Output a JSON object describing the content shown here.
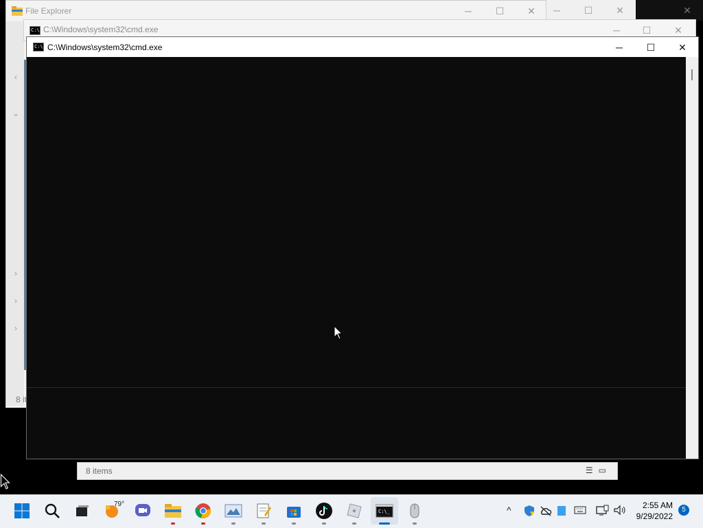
{
  "background_explorer": {
    "title": "File Explorer",
    "status": "8 it",
    "caption": {
      "minimize": "─",
      "maximize": "☐",
      "close": "✕"
    }
  },
  "bottom_explorer": {
    "status": "8 items"
  },
  "cmd_back": {
    "title": "C:\\Windows\\system32\\cmd.exe",
    "caption": {
      "minimize": "─",
      "maximize": "☐",
      "close": "✕"
    }
  },
  "cmd_active": {
    "title": "C:\\Windows\\system32\\cmd.exe",
    "icon_text": "C:\\",
    "caption": {
      "minimize": "─",
      "maximize": "☐",
      "close": "✕"
    }
  },
  "taskbar": {
    "weather_temp": "79°",
    "icons": [
      "start-icon",
      "search-icon",
      "task-view-icon",
      "weather-icon",
      "teams-chat-icon",
      "file-explorer-icon",
      "chrome-icon",
      "photos-icon",
      "notepad-icon",
      "store-icon",
      "tiktok-icon",
      "roblox-icon",
      "cmd-icon",
      "mouse-icon"
    ],
    "tray": {
      "chevron": "^",
      "time": "2:55 AM",
      "date": "9/29/2022",
      "notifications": "5"
    }
  },
  "colors": {
    "console_bg": "#0c0c0c",
    "taskbar_bg": "#eef1f6",
    "accent": "#0067c0"
  }
}
